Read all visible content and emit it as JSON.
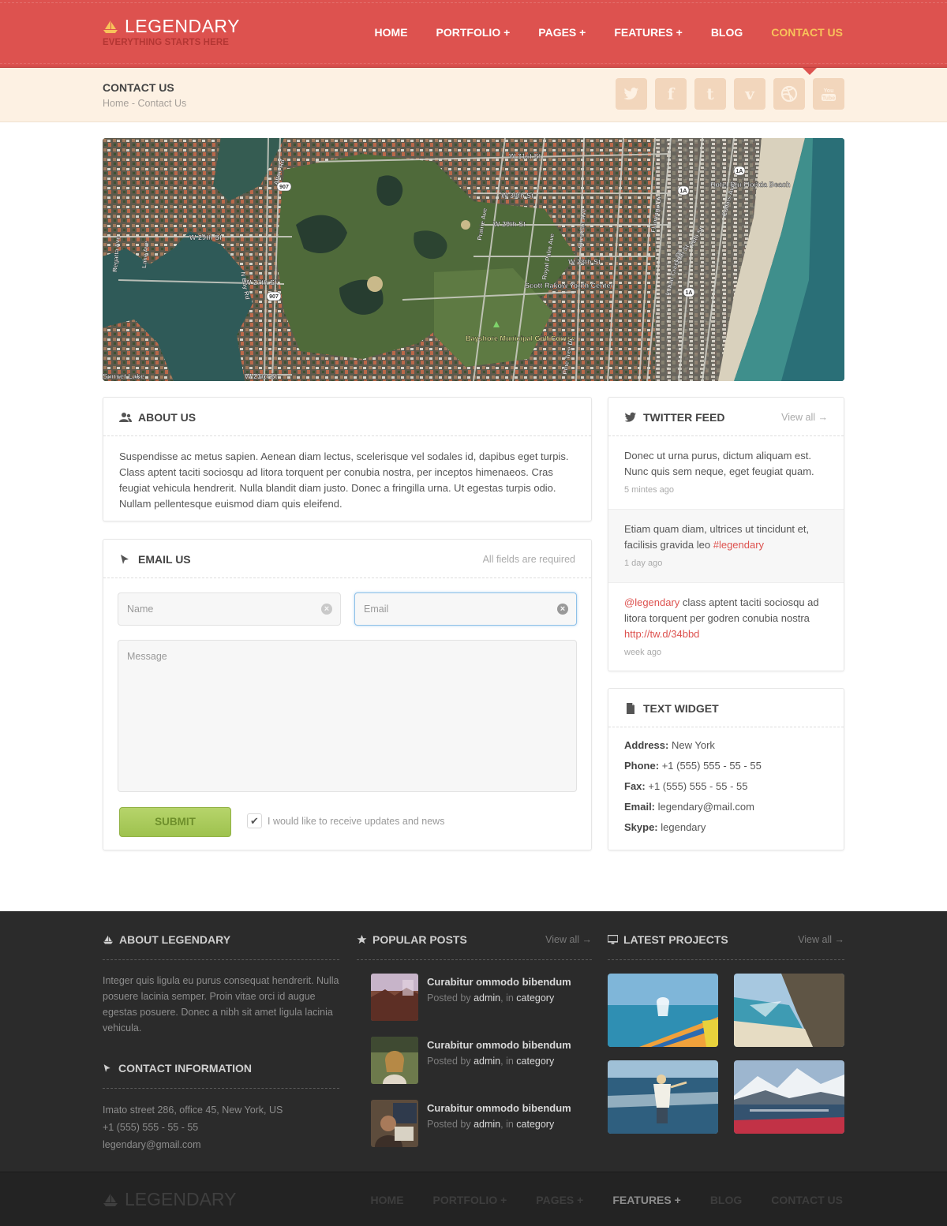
{
  "brand": {
    "name": "LEGENDARY",
    "tagline": "EVERYTHING STARTS HERE"
  },
  "nav": [
    {
      "label": "HOME"
    },
    {
      "label": "PORTFOLIO +"
    },
    {
      "label": "PAGES +"
    },
    {
      "label": "FEATURES +"
    },
    {
      "label": "BLOG"
    },
    {
      "label": "CONTACT US"
    }
  ],
  "page": {
    "title": "CONTACT US",
    "breadcrumb": "Home - Contact Us"
  },
  "socials": [
    "twitter-icon",
    "facebook-icon",
    "tumblr-icon",
    "vimeo-icon",
    "dribbble-icon",
    "youtube-icon"
  ],
  "map": {
    "labels": [
      "W 31st St",
      "W 30th St",
      "W 29th St",
      "W 28th St",
      "W 27th St",
      "W 29th St",
      "W 23rd St",
      "Alton Rd",
      "N Bay Rd",
      "Prairie Ave",
      "Royal Palm Ave",
      "Sheridan Ave",
      "Pine Tree Dr",
      "Flamingo Dr",
      "Indian Creek Dr",
      "Collins Ave",
      "29th St",
      "28th St",
      "Bayshore Municipal Golf Course",
      "Scott Rakow Youth Center",
      "Hotel Riu Florida Beach",
      "Regatta Ave",
      "Lake Ave",
      "Sunset Lake",
      "907",
      "1A"
    ]
  },
  "about": {
    "title": "ABOUT US",
    "text": "Suspendisse ac metus sapien. Aenean diam lectus, scelerisque vel sodales id, dapibus eget turpis. Class aptent taciti sociosqu ad litora torquent per conubia nostra, per inceptos himenaeos. Cras feugiat vehicula hendrerit. Nulla blandit diam justo. Donec a fringilla urna. Ut egestas turpis odio. Nullam pellentesque euismod diam quis eleifend."
  },
  "email": {
    "title": "EMAIL US",
    "note": "All fields are required",
    "name_placeholder": "Name",
    "email_placeholder": "Email",
    "message_placeholder": "Message",
    "submit": "SUBMIT",
    "checkbox_label": "I would like to receive updates and news",
    "checkbox_checked": true
  },
  "twitter": {
    "title": "TWITTER FEED",
    "view_all": "View all",
    "tweets": [
      {
        "text": "Donec ut urna purus, dictum aliquam est. Nunc quis sem neque, eget feugiat quam.",
        "time": "5 mintes ago"
      },
      {
        "text_a": "Etiam quam diam, ultrices ut tincidunt et, facilisis gravida leo ",
        "tag": "#legendary",
        "time": "1 day ago"
      },
      {
        "mention": "@legendary",
        "text_b": " class aptent taciti sociosqu ad litora torquent per godren conubia nostra ",
        "link": "http://tw.d/34bbd",
        "time": "week ago"
      }
    ]
  },
  "textwidget": {
    "title": "TEXT WIDGET",
    "rows": [
      {
        "label": "Address:",
        "value": "New York"
      },
      {
        "label": "Phone:",
        "value": "+1 (555) 555 - 55 - 55"
      },
      {
        "label": "Fax:",
        "value": "+1 (555) 555 - 55 - 55"
      },
      {
        "label": "Email:",
        "value": "legendary@mail.com"
      },
      {
        "label": "Skype:",
        "value": "legendary"
      }
    ]
  },
  "footer": {
    "about_title": "ABOUT LEGENDARY",
    "about_text": "Integer quis ligula eu purus consequat hendrerit. Nulla posuere lacinia semper. Proin vitae orci id augue egestas posuere. Donec a nibh sit amet ligula lacinia vehicula.",
    "contact_title": "CONTACT INFORMATION",
    "contact_address": "Imato street 286, office 45, New York, US",
    "contact_phone": "+1 (555) 555 - 55 - 55",
    "contact_email": "legendary@gmail.com",
    "popular_title": "POPULAR POSTS",
    "popular_view_all": "View all",
    "posts": [
      {
        "title": "Curabitur ommodo bibendum",
        "posted": "Posted by ",
        "author": "admin",
        "in": ", in ",
        "category": "category"
      },
      {
        "title": "Curabitur ommodo bibendum",
        "posted": "Posted by ",
        "author": "admin",
        "in": ", in ",
        "category": "category"
      },
      {
        "title": "Curabitur ommodo bibendum",
        "posted": "Posted by ",
        "author": "admin",
        "in": ", in ",
        "category": "category"
      }
    ],
    "projects_title": "LATEST PROJECTS",
    "projects_view_all": "View all"
  },
  "colors": {
    "brand": "#dd524f",
    "active_nav": "#f8c35a",
    "submit": "#a8ca5a",
    "footer": "#2b2b2b"
  }
}
